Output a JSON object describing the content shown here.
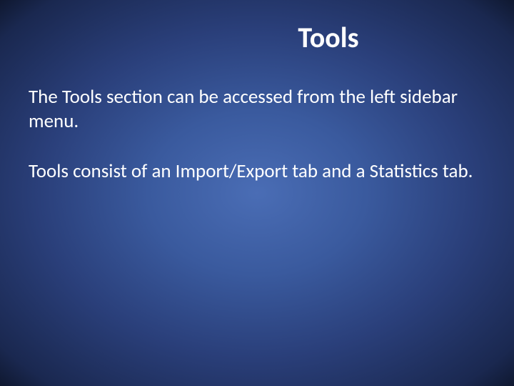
{
  "slide": {
    "title": "Tools",
    "paragraph1": "The Tools section can be accessed from the left sidebar menu.",
    "paragraph2": "Tools consist of an Import/Export tab and a Statistics tab."
  }
}
